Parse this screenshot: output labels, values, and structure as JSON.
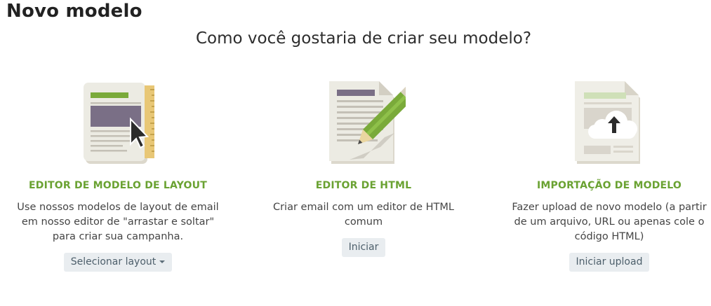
{
  "header": {
    "title": "Novo modelo",
    "subtitle": "Como você gostaria de criar seu modelo?"
  },
  "options": [
    {
      "title": "EDITOR DE MODELO DE LAYOUT",
      "description": "Use nossos modelos de layout de email em nosso editor de \"arrastar e soltar\" para criar sua campanha.",
      "button_label": "Selecionar layout",
      "icon": "layout-editor-icon"
    },
    {
      "title": "EDITOR DE HTML",
      "description": "Criar email com um editor de HTML comum",
      "button_label": "Iniciar",
      "icon": "html-editor-icon"
    },
    {
      "title": "IMPORTAÇÃO DE MODELO",
      "description": "Fazer upload de novo modelo (a partir de um arquivo, URL ou apenas cole o código HTML)",
      "button_label": "Iniciar upload",
      "icon": "upload-template-icon"
    }
  ],
  "colors": {
    "accent": "#6aa232",
    "button_bg": "#e9edf0",
    "button_text": "#4d5f6b"
  }
}
